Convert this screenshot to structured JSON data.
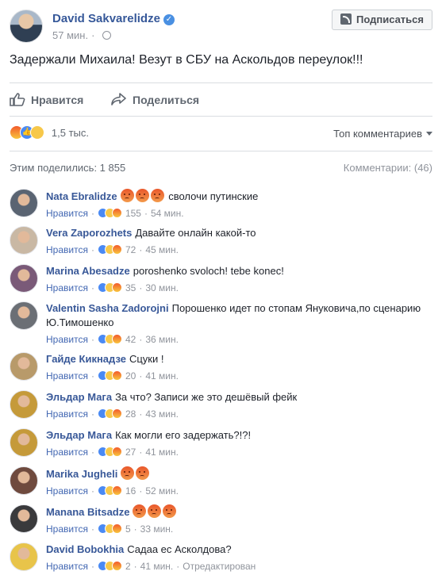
{
  "post": {
    "author": "David Sakvarelidze",
    "time": "57 мин.",
    "subscribe_label": "Подписаться",
    "text": "Задержали Михаила! Везут в СБУ на Аскольдов переулок!!!"
  },
  "actions": {
    "like_label": "Нравится",
    "share_label": "Поделиться"
  },
  "reactions": {
    "count": "1,5 тыс.",
    "sort_label": "Топ комментариев"
  },
  "stats": {
    "shares": "Этим поделились: 1 855",
    "comments": "Комментарии: (46)"
  },
  "comments": [
    {
      "name": "Nata Ebralidze",
      "text": "сволочи путинские",
      "angry_emoji": 3,
      "like_label": "Нравится",
      "reactions": "155",
      "time": "54 мин.",
      "avatar_color": "#5a6472"
    },
    {
      "name": "Vera Zaporozhets",
      "text": "Давайте онлайн какой-то",
      "angry_emoji": 0,
      "like_label": "Нравится",
      "reactions": "72",
      "time": "45 мин.",
      "avatar_color": "#c9b8a4"
    },
    {
      "name": "Marina Abesadze",
      "text": "poroshenko svoloch! tebe konec!",
      "angry_emoji": 0,
      "like_label": "Нравится",
      "reactions": "35",
      "time": "30 мин.",
      "avatar_color": "#7a5a78"
    },
    {
      "name": "Valentin Sasha Zadorojni",
      "text": "Порошенко идет по стопам Януковича,по сценарию Ю.Тимошенко",
      "angry_emoji": 0,
      "like_label": "Нравится",
      "reactions": "42",
      "time": "36 мин.",
      "avatar_color": "#6b6f75"
    },
    {
      "name": "Гайде Кикнадзе",
      "text": "Сцуки !",
      "angry_emoji": 0,
      "like_label": "Нравится",
      "reactions": "20",
      "time": "41 мин.",
      "avatar_color": "#b89a6a"
    },
    {
      "name": "Эльдар Мага",
      "text": "За что? Записи же это дешёвый фейк",
      "angry_emoji": 0,
      "like_label": "Нравится",
      "reactions": "28",
      "time": "43 мин.",
      "avatar_color": "#c59a3a"
    },
    {
      "name": "Эльдар Мага",
      "text": "Как могли его задержать?!?!",
      "angry_emoji": 0,
      "like_label": "Нравится",
      "reactions": "27",
      "time": "41 мин.",
      "avatar_color": "#c59a3a"
    },
    {
      "name": "Marika Jugheli",
      "text": "",
      "angry_emoji": 2,
      "like_label": "Нравится",
      "reactions": "16",
      "time": "52 мин.",
      "avatar_color": "#6f4a3e"
    },
    {
      "name": "Manana Bitsadze",
      "text": "",
      "angry_emoji": 3,
      "like_label": "Нравится",
      "reactions": "5",
      "time": "33 мин.",
      "avatar_color": "#3a3a3c"
    },
    {
      "name": "David Bobokhia",
      "text": "Садаа ес Асколдова?",
      "angry_emoji": 0,
      "like_label": "Нравится",
      "reactions": "2",
      "time": "41 мин.",
      "edited": "Отредактирован",
      "avatar_color": "#e8c44a"
    }
  ]
}
